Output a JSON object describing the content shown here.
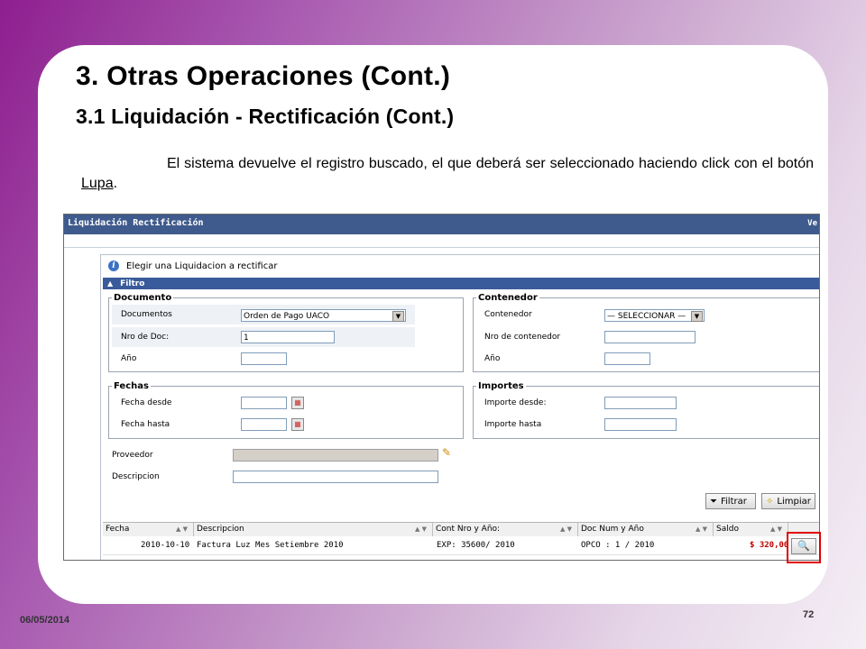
{
  "slide": {
    "title": "3. Otras Operaciones (Cont.)",
    "subtitle": "3.1 Liquidación - Rectificación (Cont.)",
    "paragraph_before": "El sistema devuelve el registro buscado, el que deberá ser seleccionado haciendo click con el botón ",
    "paragraph_link": "Lupa",
    "paragraph_after": ".",
    "date": "06/05/2014",
    "page_number": "72"
  },
  "app": {
    "header_title": "Liquidación Rectificación",
    "header_right": "Ve",
    "instruction": "Elegir una Liquidacion a rectificar",
    "filter_bar": "Filtro",
    "documento": {
      "legend": "Documento",
      "documentos_label": "Documentos",
      "documentos_value": "Orden de Pago UACO",
      "nro_doc_label": "Nro de Doc:",
      "nro_doc_value": "1",
      "anio_label": "Año",
      "anio_value": ""
    },
    "contenedor": {
      "legend": "Contenedor",
      "contenedor_label": "Contenedor",
      "contenedor_value": "— SELECCIONAR —",
      "nro_contenedor_label": "Nro de contenedor",
      "anio_label": "Año"
    },
    "fechas": {
      "legend": "Fechas",
      "desde_label": "Fecha desde",
      "hasta_label": "Fecha hasta"
    },
    "importes": {
      "legend": "Importes",
      "desde_label": "Importe desde:",
      "hasta_label": "Importe hasta"
    },
    "proveedor_label": "Proveedor",
    "descripcion_label": "Descripcion",
    "buttons": {
      "filtrar": "Filtrar",
      "limpiar": "Limpiar"
    },
    "grid": {
      "columns": [
        "Fecha",
        "Descripcion",
        "Cont Nro y Año:",
        "Doc Num y Año",
        "Saldo"
      ],
      "rows": [
        {
          "fecha": "2010-10-10",
          "descripcion": "Factura Luz Mes Setiembre 2010",
          "cont": "EXP: 35600/ 2010",
          "doc": "OPCO : 1 / 2010",
          "saldo": "$ 320,00"
        }
      ]
    }
  }
}
